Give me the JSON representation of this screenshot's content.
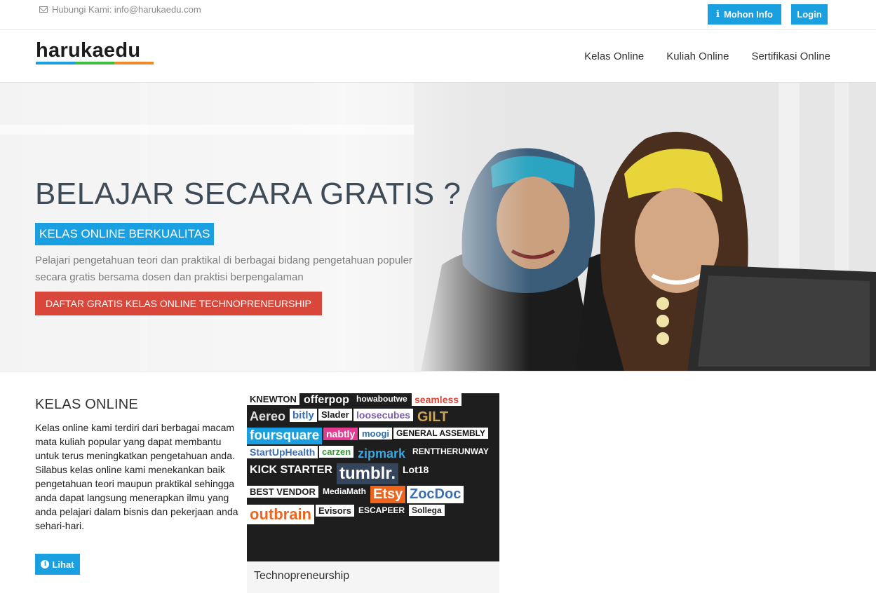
{
  "topbar": {
    "contact": "Hubungi Kami: info@harukaedu.com",
    "info_button": "Mohon Info",
    "login_button": "Login"
  },
  "navbar": {
    "logo": "harukaedu",
    "links": [
      "Kelas Online",
      "Kuliah Online",
      "Sertifikasi Online"
    ]
  },
  "hero": {
    "title": "BELAJAR SECARA GRATIS ?",
    "badge": "KELAS ONLINE BERKUALITAS",
    "description": "Pelajari pengetahuan teori dan praktikal di berbagai bidang pengetahuan populer secara gratis bersama dosen dan praktisi berpengalaman",
    "cta": "DAFTAR GRATIS KELAS ONLINE TECHNOPRENEURSHIP"
  },
  "section": {
    "title": "KELAS ONLINE",
    "body": "Kelas online kami terdiri dari berbagai macam mata kuliah popular yang dapat membantu untuk terus meningkatkan pengetahuan anda. Silabus kelas online kami menekankan baik pengetahuan teori maupun praktikal sehingga anda dapat langsung menerapkan ilmu yang anda pelajari dalam bisnis dan pekerjaan anda sehari-hari.",
    "button": "Lihat"
  },
  "card": {
    "caption": "Technopreneurship",
    "logos": [
      {
        "text": "KNEWTON",
        "bg": "#ffffff",
        "fg": "#222222"
      },
      {
        "text": "offerpop",
        "bg": "#1e1e1e",
        "fg": "#ffffff"
      },
      {
        "text": "howaboutwe",
        "bg": "#1e1e1e",
        "fg": "#ffffff"
      },
      {
        "text": "seamless",
        "bg": "#ffffff",
        "fg": "#d9463a"
      },
      {
        "text": "Aereo",
        "bg": "#1e1e1e",
        "fg": "#dddddd"
      },
      {
        "text": "bitly",
        "bg": "#ffffff",
        "fg": "#3b6fb6"
      },
      {
        "text": "Slader",
        "bg": "#ffffff",
        "fg": "#222222"
      },
      {
        "text": "loosecubes",
        "bg": "#ffffff",
        "fg": "#7a5ca8"
      },
      {
        "text": "GILT",
        "bg": "#1e1e1e",
        "fg": "#c9a45a"
      },
      {
        "text": "foursquare",
        "bg": "#1a9fe0",
        "fg": "#ffffff"
      },
      {
        "text": "nabtly",
        "bg": "#e23d92",
        "fg": "#ffffff"
      },
      {
        "text": "moogi",
        "bg": "#ffffff",
        "fg": "#2a6fb0"
      },
      {
        "text": "GENERAL ASSEMBLY",
        "bg": "#ffffff",
        "fg": "#111111"
      },
      {
        "text": "StartUpHealth",
        "bg": "#ffffff",
        "fg": "#3b6fb6"
      },
      {
        "text": "carzen",
        "bg": "#ffffff",
        "fg": "#3a9a3a"
      },
      {
        "text": "zipmark",
        "bg": "#1e1e1e",
        "fg": "#3aa7e0"
      },
      {
        "text": "RENTTHERUNWAY",
        "bg": "#1e1e1e",
        "fg": "#ffffff"
      },
      {
        "text": "KICK STARTER",
        "bg": "#1e1e1e",
        "fg": "#ffffff"
      },
      {
        "text": "tumblr.",
        "bg": "#35465c",
        "fg": "#ffffff"
      },
      {
        "text": "Lot18",
        "bg": "#1e1e1e",
        "fg": "#ffffff"
      },
      {
        "text": "BEST VENDOR",
        "bg": "#ffffff",
        "fg": "#222222"
      },
      {
        "text": "MediaMath",
        "bg": "#1e1e1e",
        "fg": "#ffffff"
      },
      {
        "text": "Etsy",
        "bg": "#f1641e",
        "fg": "#ffffff"
      },
      {
        "text": "ZocDoc",
        "bg": "#ffffff",
        "fg": "#3b6fb6"
      },
      {
        "text": "outbrain",
        "bg": "#ffffff",
        "fg": "#f1641e"
      },
      {
        "text": "Evisors",
        "bg": "#ffffff",
        "fg": "#222222"
      },
      {
        "text": "ESCAPEER",
        "bg": "#1e1e1e",
        "fg": "#ffffff"
      },
      {
        "text": "Sollega",
        "bg": "#ffffff",
        "fg": "#222222"
      }
    ]
  }
}
